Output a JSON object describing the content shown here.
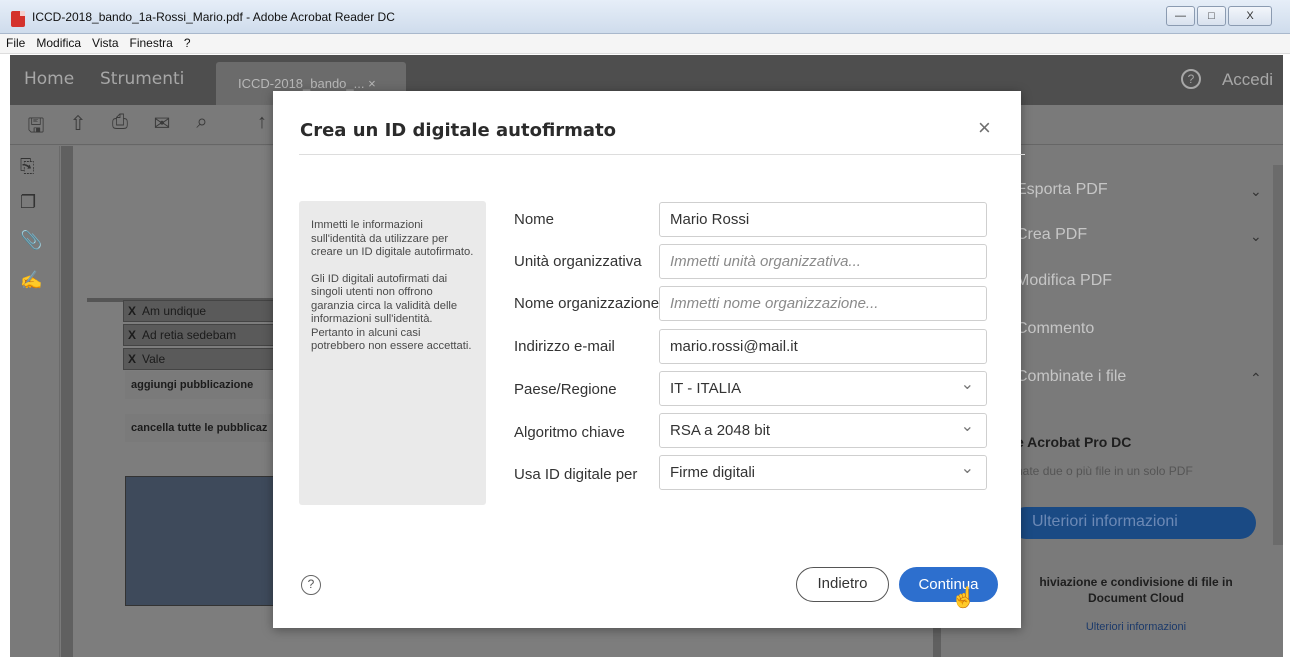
{
  "window": {
    "title": "ICCD-2018_bando_1a-Rossi_Mario.pdf - Adobe Acrobat Reader DC",
    "minimize": "—",
    "maximize": "□",
    "close": "X"
  },
  "menu": [
    "File",
    "Modifica",
    "Vista",
    "Finestra",
    "?"
  ],
  "tabs": {
    "home": "Home",
    "tools": "Strumenti",
    "document": "ICCD-2018_bando_... ×",
    "help": "?",
    "signin": "Accedi"
  },
  "document": {
    "publications": [
      "Am undique",
      "Ad retia sedebam",
      "Vale"
    ],
    "remove_marker": "X",
    "add_publication": "aggiungi pubblicazione",
    "clear_publications": "cancella tutte le pubblicaz"
  },
  "right_pane": {
    "items": [
      "Esporta PDF",
      "Crea PDF",
      "Modifica PDF",
      "Commento",
      "Combinate i file"
    ],
    "pro_title": "e Acrobat Pro DC",
    "pro_subtitle": "nate due o più file in un solo PDF",
    "more_button": "Ulteriori informazioni",
    "cloud_text": "hiviazione e condivisione di file in Document Cloud",
    "cloud_link": "Ulteriori informazioni"
  },
  "dialog": {
    "title": "Crea un ID digitale autofirmato",
    "close": "×",
    "info_paragraphs": [
      "Immetti le informazioni sull'identità da utilizzare per creare un ID digitale autofirmato.",
      "Gli ID digitali autofirmati dai singoli utenti non offrono garanzia circa la validità delle informazioni sull'identità. Pertanto in alcuni casi potrebbero non essere accettati."
    ],
    "fields": {
      "name": {
        "label": "Nome",
        "value": "Mario Rossi"
      },
      "org_unit": {
        "label": "Unità organizzativa",
        "placeholder": "Immetti unità organizzativa..."
      },
      "org_name": {
        "label": "Nome organizzazione",
        "placeholder": "Immetti nome organizzazione..."
      },
      "email": {
        "label": "Indirizzo e-mail",
        "value": "mario.rossi@mail.it"
      },
      "country": {
        "label": "Paese/Regione",
        "value": "IT - ITALIA"
      },
      "key_algorithm": {
        "label": "Algoritmo chiave",
        "value": "RSA a 2048 bit"
      },
      "usage": {
        "label": "Usa ID digitale per",
        "value": "Firme digitali"
      }
    },
    "help": "?",
    "back_button": "Indietro",
    "continue_button": "Continua"
  }
}
